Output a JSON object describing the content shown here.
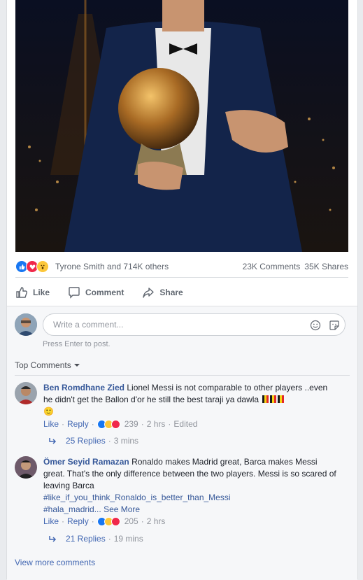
{
  "post": {
    "reaction_summary": "Tyrone Smith and 714K others",
    "comments_count": "23K Comments",
    "shares_count": "35K Shares",
    "reaction_icons": [
      "like-reaction-icon",
      "love-reaction-icon",
      "wow-reaction-icon"
    ]
  },
  "actions": {
    "like": "Like",
    "comment": "Comment",
    "share": "Share"
  },
  "composer": {
    "placeholder": "Write a comment...",
    "hint": "Press Enter to post."
  },
  "sort": {
    "label": "Top Comments"
  },
  "comments": [
    {
      "author": "Ben Romdhane Zied",
      "text": "Lionel Messi is not comparable to other players ..even he didn't get the Ballon d'or he still the best taraji ya dawla",
      "emoji": "🙂",
      "like": "Like",
      "reply": "Reply",
      "reaction_count": "239",
      "time": "2 hrs",
      "edited": "Edited",
      "replies": "25 Replies",
      "replies_time": "3 mins"
    },
    {
      "author": "Ömer Seyid Ramazan",
      "text": "Ronaldo makes Madrid great, Barca makes Messi great. That's the only difference between the two players. Messi is so scared of leaving Barca",
      "hashtag1": "#like_if_you_think_Ronaldo_is_better_than_Messi",
      "hashtag2": "#hala_madrid...",
      "see_more": "See More",
      "like": "Like",
      "reply": "Reply",
      "reaction_count": "205",
      "time": "2 hrs",
      "replies": "21 Replies",
      "replies_time": "19 mins"
    }
  ],
  "view_more": "View more comments",
  "colors": {
    "link": "#4267b2",
    "name": "#365899",
    "like_blue": "#1877f2",
    "love_red": "#f0284a",
    "wow_yellow": "#fcc73b"
  }
}
